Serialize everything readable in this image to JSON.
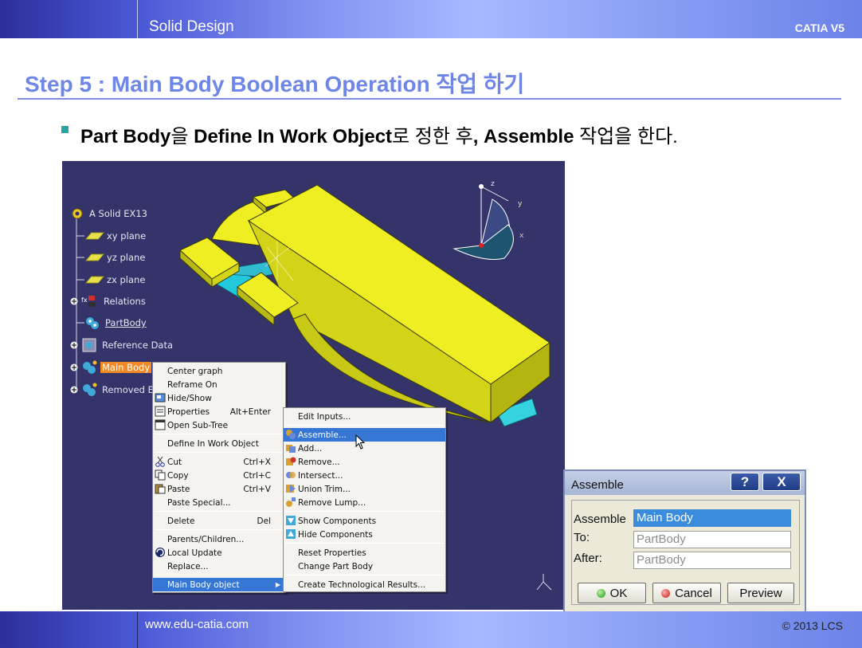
{
  "header": {
    "title": "Solid Design",
    "brand": "CATIA V5"
  },
  "footer": {
    "website": "www.edu-catia.com",
    "copyright": "© 2013 LCS"
  },
  "slide": {
    "step_title": "Step 5 : Main Body Boolean Operation 작업 하기",
    "bullet": {
      "b1": "Part Body",
      "t1": "을 ",
      "b2": "Define In Work Object",
      "t2": "로 정한 후",
      "b3": ", Assemble",
      "t3": " 작업을 한다."
    }
  },
  "compass": {
    "z": "z",
    "y": "y",
    "x": "x"
  },
  "tree": {
    "root": "A Solid EX13",
    "items": [
      {
        "label": "xy plane",
        "icon": "plane-icon"
      },
      {
        "label": "yz plane",
        "icon": "plane-icon"
      },
      {
        "label": "zx plane",
        "icon": "plane-icon"
      },
      {
        "label": "Relations",
        "icon": "relations-icon"
      },
      {
        "label": "PartBody",
        "icon": "body-icon"
      },
      {
        "label": "Reference Data",
        "icon": "reference-icon"
      },
      {
        "label": "Main Body",
        "icon": "body-icon"
      },
      {
        "label": "Removed B",
        "icon": "body-icon"
      }
    ]
  },
  "context_menu": {
    "items": [
      {
        "label": "Center graph",
        "shortcut": ""
      },
      {
        "label": "Reframe On",
        "shortcut": ""
      },
      {
        "label": "Hide/Show",
        "shortcut": ""
      },
      {
        "label": "Properties",
        "shortcut": "Alt+Enter"
      },
      {
        "label": "Open Sub-Tree",
        "shortcut": ""
      },
      {
        "label": "Define In Work Object",
        "shortcut": ""
      },
      {
        "label": "Cut",
        "shortcut": "Ctrl+X"
      },
      {
        "label": "Copy",
        "shortcut": "Ctrl+C"
      },
      {
        "label": "Paste",
        "shortcut": "Ctrl+V"
      },
      {
        "label": "Paste Special...",
        "shortcut": ""
      },
      {
        "label": "Delete",
        "shortcut": "Del"
      },
      {
        "label": "Parents/Children...",
        "shortcut": ""
      },
      {
        "label": "Local Update",
        "shortcut": ""
      },
      {
        "label": "Replace...",
        "shortcut": ""
      },
      {
        "label": "Main Body object",
        "shortcut": ""
      }
    ]
  },
  "submenu": {
    "items": [
      "Edit Inputs...",
      "Assemble...",
      "Add...",
      "Remove...",
      "Intersect...",
      "Union Trim...",
      "Remove Lump...",
      "Show Components",
      "Hide Components",
      "Reset Properties",
      "Change Part Body",
      "Create Technological Results..."
    ]
  },
  "dialog": {
    "title": "Assemble",
    "help": "?",
    "close": "X",
    "assemble_label": "Assemble",
    "assemble_value": "Main Body",
    "to_label": "To:",
    "to_value": "PartBody",
    "after_label": "After:",
    "after_value": "PartBody",
    "ok": "OK",
    "cancel": "Cancel",
    "preview": "Preview"
  },
  "colors": {
    "viewport_bg": "#34346a",
    "solid_yellow": "#eeee22",
    "selection_orange": "#ef8a26",
    "menu_highlight": "#3676d4",
    "title_blue": "#6e86e8"
  }
}
